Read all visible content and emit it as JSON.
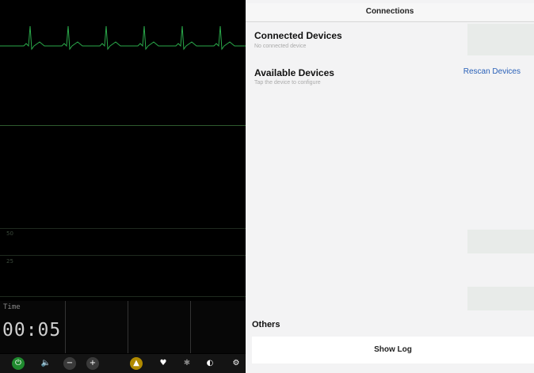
{
  "monitor": {
    "time_label": "Time",
    "time_value": "00:05",
    "scale_labels": [
      "50",
      "25"
    ]
  },
  "controls": [
    {
      "icon": "power-icon",
      "color": "#1f8a2e"
    },
    {
      "icon": "speaker-icon",
      "color": "#3a3a3a"
    },
    {
      "icon": "minus-icon",
      "color": "#3a3a3a"
    },
    {
      "icon": "plus-icon",
      "color": "#3a3a3a"
    },
    {
      "icon": "bell-icon",
      "color": "#b08a00"
    },
    {
      "icon": "heart-icon",
      "color": "#3a3a3a"
    },
    {
      "icon": "snowflake-icon",
      "color": "#3a3a3a"
    },
    {
      "icon": "contrast-icon",
      "color": "#3a3a3a"
    },
    {
      "icon": "gear-icon",
      "color": "#3a3a3a"
    }
  ],
  "panel": {
    "title": "Connections",
    "connected": {
      "title": "Connected Devices",
      "subtitle": "No connected device"
    },
    "available": {
      "title": "Available Devices",
      "subtitle": "Tap the device to configure",
      "rescan_label": "Rescan Devices"
    },
    "others": {
      "title": "Others",
      "show_log_label": "Show Log"
    }
  },
  "colors": {
    "ecg": "#2aa84a",
    "link": "#2a61b8"
  }
}
